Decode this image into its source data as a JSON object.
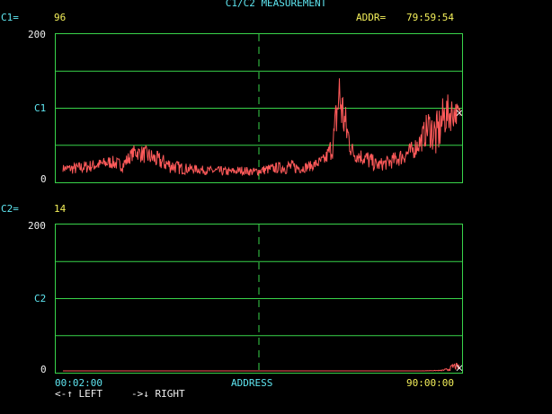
{
  "title": "C1/C2 MEASUREMENT",
  "addr": {
    "label": "ADDR=",
    "value": "79:59:54"
  },
  "channels": [
    {
      "label": "C1=",
      "value": "96",
      "axis_name": "C1",
      "y_max": "200",
      "y_min": "0"
    },
    {
      "label": "C2=",
      "value": "14",
      "axis_name": "C2",
      "y_max": "200",
      "y_min": "0"
    }
  ],
  "x_axis": {
    "start": "00:02:00",
    "label": "ADDRESS",
    "end": "90:00:00"
  },
  "nav": {
    "left": "<-↑ LEFT",
    "right": "->↓ RIGHT"
  },
  "colors": {
    "grid": "#39d44a",
    "trace": "#ff5a5a",
    "label": "#5fe7f2",
    "value": "#f4f05a",
    "background": "#000000"
  },
  "chart_data": [
    {
      "type": "line",
      "name": "C1",
      "ylim": [
        0,
        200
      ],
      "x_range": [
        "00:02:00",
        "90:00:00"
      ],
      "grid": true,
      "envelope": [
        [
          0.0,
          12,
          22
        ],
        [
          0.03,
          8,
          25
        ],
        [
          0.06,
          10,
          28
        ],
        [
          0.09,
          14,
          30
        ],
        [
          0.12,
          16,
          35
        ],
        [
          0.15,
          12,
          30
        ],
        [
          0.18,
          30,
          50
        ],
        [
          0.21,
          22,
          48
        ],
        [
          0.24,
          15,
          40
        ],
        [
          0.27,
          10,
          32
        ],
        [
          0.3,
          8,
          25
        ],
        [
          0.33,
          10,
          22
        ],
        [
          0.36,
          8,
          20
        ],
        [
          0.39,
          6,
          20
        ],
        [
          0.42,
          6,
          18
        ],
        [
          0.45,
          8,
          20
        ],
        [
          0.48,
          6,
          18
        ],
        [
          0.51,
          8,
          22
        ],
        [
          0.54,
          10,
          25
        ],
        [
          0.57,
          8,
          30
        ],
        [
          0.6,
          10,
          24
        ],
        [
          0.63,
          14,
          28
        ],
        [
          0.66,
          20,
          38
        ],
        [
          0.68,
          30,
          70
        ],
        [
          0.695,
          70,
          168
        ],
        [
          0.71,
          45,
          110
        ],
        [
          0.73,
          25,
          50
        ],
        [
          0.75,
          22,
          45
        ],
        [
          0.77,
          15,
          42
        ],
        [
          0.79,
          12,
          30
        ],
        [
          0.82,
          15,
          35
        ],
        [
          0.85,
          20,
          45
        ],
        [
          0.88,
          28,
          55
        ],
        [
          0.9,
          38,
          70
        ],
        [
          0.92,
          50,
          100
        ],
        [
          0.94,
          25,
          95
        ],
        [
          0.96,
          60,
          120
        ],
        [
          0.98,
          70,
          118
        ],
        [
          1.0,
          85,
          102
        ]
      ]
    },
    {
      "type": "line",
      "name": "C2",
      "ylim": [
        0,
        200
      ],
      "x_range": [
        "00:02:00",
        "90:00:00"
      ],
      "grid": true,
      "envelope": [
        [
          0.0,
          0,
          0
        ],
        [
          0.9,
          0,
          0
        ],
        [
          0.95,
          0,
          1
        ],
        [
          0.97,
          0,
          4
        ],
        [
          0.985,
          2,
          12
        ],
        [
          1.0,
          0,
          8
        ]
      ]
    }
  ]
}
